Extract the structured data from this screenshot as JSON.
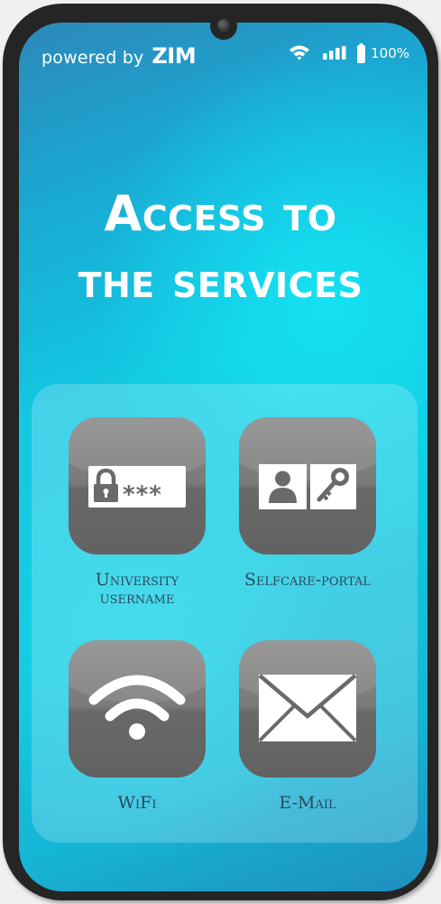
{
  "branding": {
    "powered_text": "powered by",
    "logo_text": "ZIM"
  },
  "status": {
    "wifi_icon": "wifi-icon",
    "signal_icon": "signal-bars-icon",
    "battery_icon": "battery-icon",
    "battery": "100%"
  },
  "title": {
    "line1": "Access to",
    "line2": "the services"
  },
  "services": [
    {
      "line1": "University",
      "line2": "username",
      "icon": "lock-password-icon"
    },
    {
      "line1": "Selfcare-portal",
      "icon": "user-key-icon"
    },
    {
      "line1": "WiFi",
      "icon": "wifi-icon"
    },
    {
      "line1": "E-Mail",
      "icon": "envelope-icon"
    }
  ],
  "colors": {
    "screen_accent": "#13c9e2",
    "frame": "#252525",
    "tile": "#7a7a7a",
    "label": "#2b4a5e"
  }
}
